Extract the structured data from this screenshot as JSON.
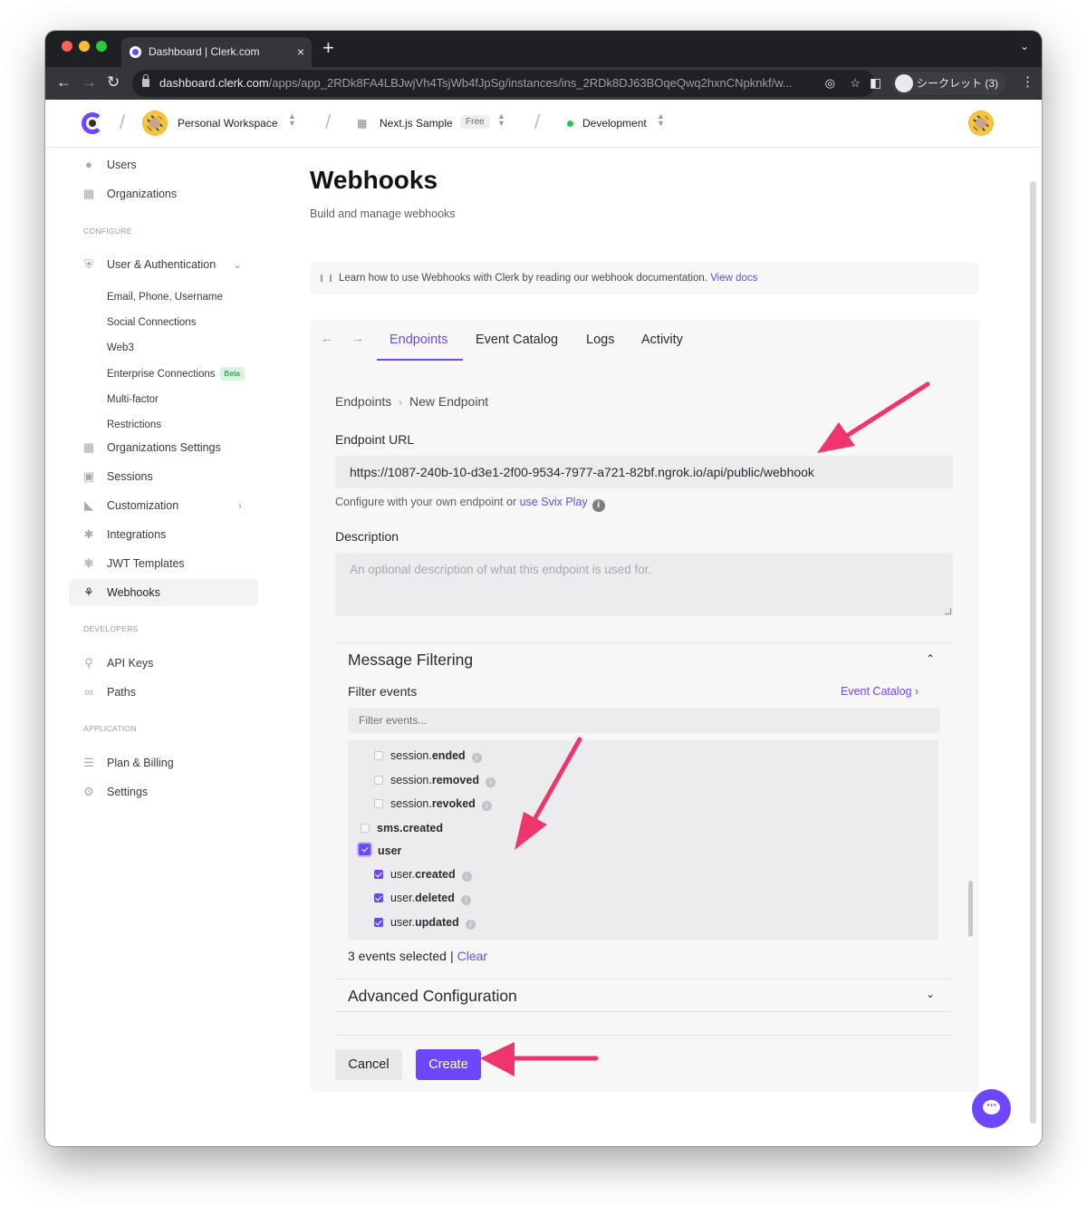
{
  "browser": {
    "tab_title": "Dashboard | Clerk.com",
    "tab_close": "×",
    "new_tab": "+",
    "url_host": "dashboard.clerk.com",
    "url_path": "/apps/app_2RDk8FA4LBJwjVh4TsjWb4fJpSg/instances/ins_2RDk8DJ63BOqeQwq2hxnCNpknkf/w...",
    "incognito_label": "シークレット (3)"
  },
  "topnav": {
    "workspace": "Personal Workspace",
    "app": "Next.js Sample",
    "plan_badge": "Free",
    "instance": "Development"
  },
  "sidebar": {
    "items_top": [
      {
        "label": "Users",
        "icon": "users-icon"
      },
      {
        "label": "Organizations",
        "icon": "building-icon"
      }
    ],
    "configure_heading": "CONFIGURE",
    "user_auth": "User & Authentication",
    "user_auth_subitems": [
      "Email, Phone, Username",
      "Social Connections",
      "Web3",
      "Enterprise Connections",
      "Multi-factor",
      "Restrictions"
    ],
    "beta_badge": "Beta",
    "items_configure": [
      {
        "label": "Organizations Settings",
        "icon": "building-icon"
      },
      {
        "label": "Sessions",
        "icon": "lock-icon"
      },
      {
        "label": "Customization",
        "icon": "palette-icon"
      },
      {
        "label": "Integrations",
        "icon": "puzzle-icon"
      },
      {
        "label": "JWT Templates",
        "icon": "gear-sun-icon"
      },
      {
        "label": "Webhooks",
        "icon": "webhook-icon"
      }
    ],
    "developers_heading": "DEVELOPERS",
    "items_developers": [
      {
        "label": "API Keys",
        "icon": "key-icon"
      },
      {
        "label": "Paths",
        "icon": "link-icon"
      }
    ],
    "application_heading": "APPLICATION",
    "items_application": [
      {
        "label": "Plan & Billing",
        "icon": "billing-icon"
      },
      {
        "label": "Settings",
        "icon": "gear-icon"
      }
    ]
  },
  "main": {
    "title": "Webhooks",
    "subtitle": "Build and manage webhooks",
    "notice_text": "Learn how to use Webhooks with Clerk by reading our webhook documentation.",
    "notice_link": "View docs"
  },
  "svix": {
    "tabs": [
      "Endpoints",
      "Event Catalog",
      "Logs",
      "Activity"
    ],
    "active_tab": "Endpoints",
    "breadcrumb": [
      "Endpoints",
      "New Endpoint"
    ],
    "endpoint_url_label": "Endpoint URL",
    "endpoint_url_value": "https://1087-240b-10-d3e1-2f00-9534-7977-a721-82bf.ngrok.io/api/public/webhook",
    "help_text": "Configure with your own endpoint or",
    "help_link": "use Svix Play",
    "description_label": "Description",
    "description_placeholder": "An optional description of what this endpoint is used for.",
    "message_filtering": "Message Filtering",
    "filter_events_label": "Filter events",
    "event_catalog_link": "Event Catalog",
    "filter_placeholder": "Filter events...",
    "events": [
      {
        "prefix": "session.",
        "name": "ended",
        "checked": false,
        "level": 2,
        "info": true
      },
      {
        "prefix": "session.",
        "name": "removed",
        "checked": false,
        "level": 2,
        "info": true
      },
      {
        "prefix": "session.",
        "name": "revoked",
        "checked": false,
        "level": 2,
        "info": true
      },
      {
        "prefix": "",
        "name": "sms.created",
        "checked": false,
        "level": 1,
        "info": false
      },
      {
        "prefix": "",
        "name": "user",
        "checked": true,
        "level": 1,
        "info": false
      },
      {
        "prefix": "user.",
        "name": "created",
        "checked": true,
        "level": 2,
        "info": true
      },
      {
        "prefix": "user.",
        "name": "deleted",
        "checked": true,
        "level": 2,
        "info": true
      },
      {
        "prefix": "user.",
        "name": "updated",
        "checked": true,
        "level": 2,
        "info": true
      }
    ],
    "selected_count": "3 events selected",
    "clear_label": "Clear",
    "advanced": "Advanced Configuration",
    "cancel": "Cancel",
    "create": "Create"
  },
  "colors": {
    "accent": "#6c47ff",
    "annotation_arrow": "#f0356c",
    "status_green": "#22c55e"
  }
}
